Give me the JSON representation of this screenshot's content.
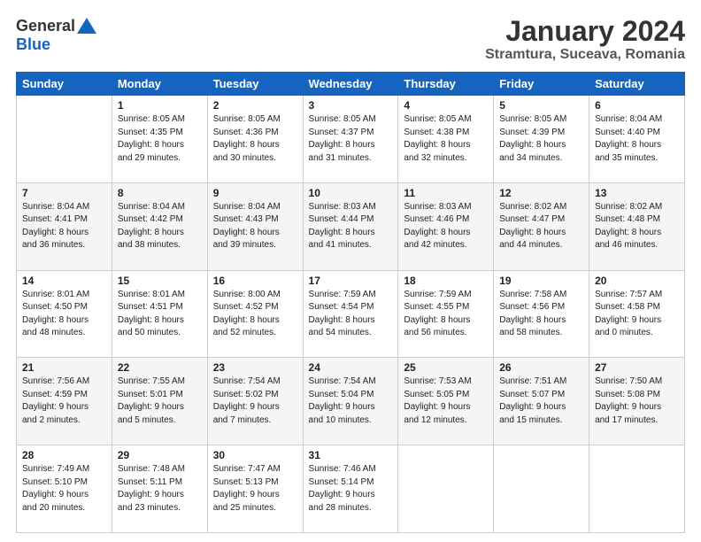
{
  "header": {
    "logo_general": "General",
    "logo_blue": "Blue",
    "month_title": "January 2024",
    "location": "Stramtura, Suceava, Romania"
  },
  "columns": [
    "Sunday",
    "Monday",
    "Tuesday",
    "Wednesday",
    "Thursday",
    "Friday",
    "Saturday"
  ],
  "weeks": [
    [
      {
        "day": "",
        "info": ""
      },
      {
        "day": "1",
        "info": "Sunrise: 8:05 AM\nSunset: 4:35 PM\nDaylight: 8 hours\nand 29 minutes."
      },
      {
        "day": "2",
        "info": "Sunrise: 8:05 AM\nSunset: 4:36 PM\nDaylight: 8 hours\nand 30 minutes."
      },
      {
        "day": "3",
        "info": "Sunrise: 8:05 AM\nSunset: 4:37 PM\nDaylight: 8 hours\nand 31 minutes."
      },
      {
        "day": "4",
        "info": "Sunrise: 8:05 AM\nSunset: 4:38 PM\nDaylight: 8 hours\nand 32 minutes."
      },
      {
        "day": "5",
        "info": "Sunrise: 8:05 AM\nSunset: 4:39 PM\nDaylight: 8 hours\nand 34 minutes."
      },
      {
        "day": "6",
        "info": "Sunrise: 8:04 AM\nSunset: 4:40 PM\nDaylight: 8 hours\nand 35 minutes."
      }
    ],
    [
      {
        "day": "7",
        "info": "Sunrise: 8:04 AM\nSunset: 4:41 PM\nDaylight: 8 hours\nand 36 minutes."
      },
      {
        "day": "8",
        "info": "Sunrise: 8:04 AM\nSunset: 4:42 PM\nDaylight: 8 hours\nand 38 minutes."
      },
      {
        "day": "9",
        "info": "Sunrise: 8:04 AM\nSunset: 4:43 PM\nDaylight: 8 hours\nand 39 minutes."
      },
      {
        "day": "10",
        "info": "Sunrise: 8:03 AM\nSunset: 4:44 PM\nDaylight: 8 hours\nand 41 minutes."
      },
      {
        "day": "11",
        "info": "Sunrise: 8:03 AM\nSunset: 4:46 PM\nDaylight: 8 hours\nand 42 minutes."
      },
      {
        "day": "12",
        "info": "Sunrise: 8:02 AM\nSunset: 4:47 PM\nDaylight: 8 hours\nand 44 minutes."
      },
      {
        "day": "13",
        "info": "Sunrise: 8:02 AM\nSunset: 4:48 PM\nDaylight: 8 hours\nand 46 minutes."
      }
    ],
    [
      {
        "day": "14",
        "info": "Sunrise: 8:01 AM\nSunset: 4:50 PM\nDaylight: 8 hours\nand 48 minutes."
      },
      {
        "day": "15",
        "info": "Sunrise: 8:01 AM\nSunset: 4:51 PM\nDaylight: 8 hours\nand 50 minutes."
      },
      {
        "day": "16",
        "info": "Sunrise: 8:00 AM\nSunset: 4:52 PM\nDaylight: 8 hours\nand 52 minutes."
      },
      {
        "day": "17",
        "info": "Sunrise: 7:59 AM\nSunset: 4:54 PM\nDaylight: 8 hours\nand 54 minutes."
      },
      {
        "day": "18",
        "info": "Sunrise: 7:59 AM\nSunset: 4:55 PM\nDaylight: 8 hours\nand 56 minutes."
      },
      {
        "day": "19",
        "info": "Sunrise: 7:58 AM\nSunset: 4:56 PM\nDaylight: 8 hours\nand 58 minutes."
      },
      {
        "day": "20",
        "info": "Sunrise: 7:57 AM\nSunset: 4:58 PM\nDaylight: 9 hours\nand 0 minutes."
      }
    ],
    [
      {
        "day": "21",
        "info": "Sunrise: 7:56 AM\nSunset: 4:59 PM\nDaylight: 9 hours\nand 2 minutes."
      },
      {
        "day": "22",
        "info": "Sunrise: 7:55 AM\nSunset: 5:01 PM\nDaylight: 9 hours\nand 5 minutes."
      },
      {
        "day": "23",
        "info": "Sunrise: 7:54 AM\nSunset: 5:02 PM\nDaylight: 9 hours\nand 7 minutes."
      },
      {
        "day": "24",
        "info": "Sunrise: 7:54 AM\nSunset: 5:04 PM\nDaylight: 9 hours\nand 10 minutes."
      },
      {
        "day": "25",
        "info": "Sunrise: 7:53 AM\nSunset: 5:05 PM\nDaylight: 9 hours\nand 12 minutes."
      },
      {
        "day": "26",
        "info": "Sunrise: 7:51 AM\nSunset: 5:07 PM\nDaylight: 9 hours\nand 15 minutes."
      },
      {
        "day": "27",
        "info": "Sunrise: 7:50 AM\nSunset: 5:08 PM\nDaylight: 9 hours\nand 17 minutes."
      }
    ],
    [
      {
        "day": "28",
        "info": "Sunrise: 7:49 AM\nSunset: 5:10 PM\nDaylight: 9 hours\nand 20 minutes."
      },
      {
        "day": "29",
        "info": "Sunrise: 7:48 AM\nSunset: 5:11 PM\nDaylight: 9 hours\nand 23 minutes."
      },
      {
        "day": "30",
        "info": "Sunrise: 7:47 AM\nSunset: 5:13 PM\nDaylight: 9 hours\nand 25 minutes."
      },
      {
        "day": "31",
        "info": "Sunrise: 7:46 AM\nSunset: 5:14 PM\nDaylight: 9 hours\nand 28 minutes."
      },
      {
        "day": "",
        "info": ""
      },
      {
        "day": "",
        "info": ""
      },
      {
        "day": "",
        "info": ""
      }
    ]
  ]
}
